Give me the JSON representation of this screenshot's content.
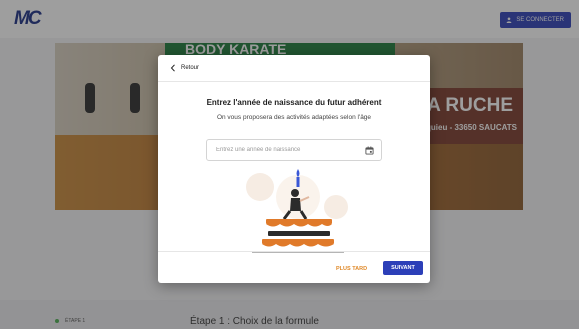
{
  "app": {
    "logo_text": "MC",
    "login_label": "SE CONNECTER"
  },
  "banner": {
    "stripe_text": "BODY KARATE",
    "sign_title": "DE LA RUCHE",
    "sign_subtitle": "squieu - 33650 SAUCATS"
  },
  "steps": {
    "side_label": "ÉTAPE 1",
    "current_title": "Étape 1 : Choix de la formule"
  },
  "modal": {
    "back_label": "Retour",
    "title": "Entrez l'année de naissance du futur adhérent",
    "subtitle": "On vous proposera des activités adaptées selon l'âge",
    "year_input": {
      "value": "",
      "placeholder": "Entrez une année de naissance"
    },
    "later_label": "PLUS TARD",
    "next_label": "SUIVANT"
  },
  "colors": {
    "primary": "#2c3fb8",
    "accent_orange": "#e08a2a",
    "logo": "#1b2f86"
  },
  "icons": {
    "back": "chevron-left-icon",
    "user": "user-icon",
    "calendar": "calendar-icon"
  }
}
